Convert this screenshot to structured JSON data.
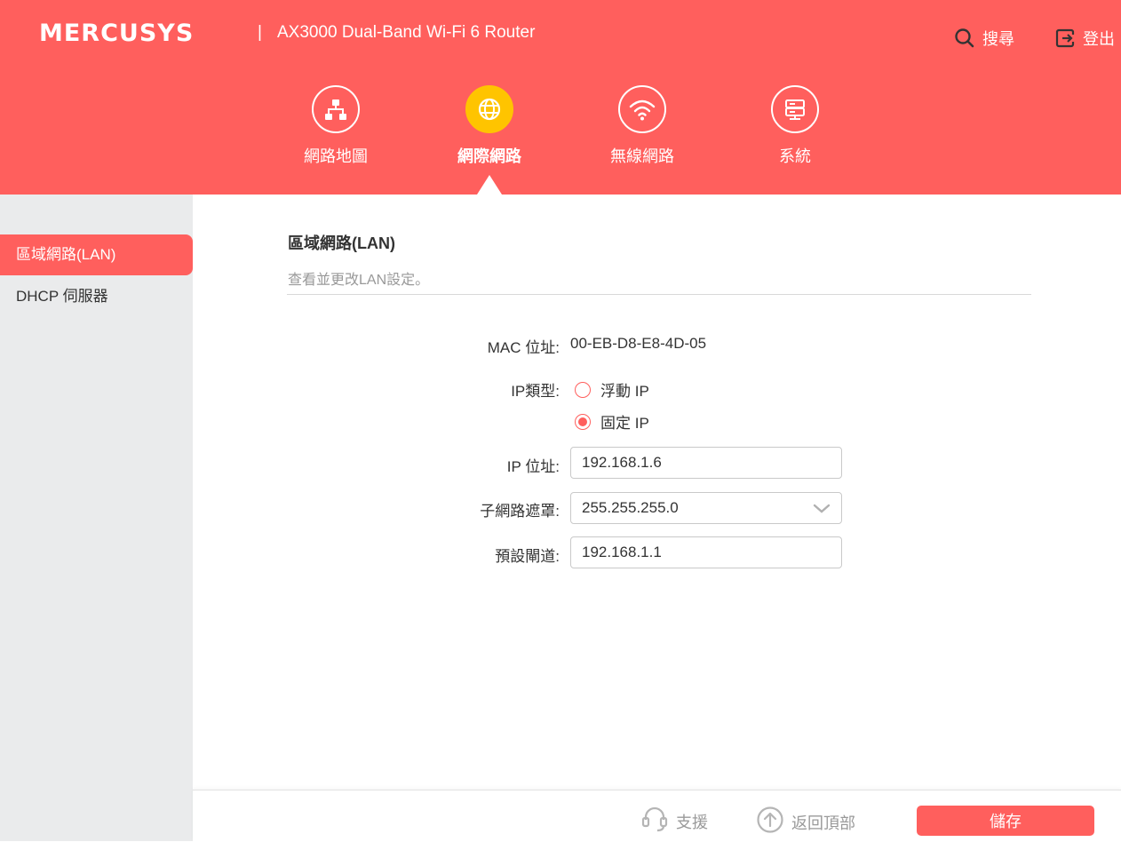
{
  "header": {
    "brand": "MERCUSYS",
    "separator": "|",
    "model": "AX3000 Dual-Band Wi-Fi 6 Router",
    "search_label": "搜尋",
    "logout_label": "登出"
  },
  "nav": {
    "tabs": [
      {
        "label": "網路地圖",
        "icon": "network-map-icon",
        "active": false
      },
      {
        "label": "網際網路",
        "icon": "globe-icon",
        "active": true
      },
      {
        "label": "無線網路",
        "icon": "wifi-icon",
        "active": false
      },
      {
        "label": "系統",
        "icon": "system-icon",
        "active": false
      }
    ]
  },
  "sidebar": {
    "items": [
      {
        "label": "區域網路(LAN)",
        "active": true
      },
      {
        "label": "DHCP 伺服器",
        "active": false
      }
    ]
  },
  "main": {
    "title": "區域網路(LAN)",
    "description": "查看並更改LAN設定。",
    "mac_label": "MAC 位址:",
    "mac_value": "00-EB-D8-E8-4D-05",
    "ip_type_label": "IP類型:",
    "ip_type_options": [
      {
        "label": "浮動 IP",
        "selected": false
      },
      {
        "label": "固定 IP",
        "selected": true
      }
    ],
    "ip_label": "IP 位址:",
    "ip_value": "192.168.1.6",
    "subnet_label": "子網路遮罩:",
    "subnet_value": "255.255.255.0",
    "gateway_label": "預設閘道:",
    "gateway_value": "192.168.1.1"
  },
  "footer": {
    "support_label": "支援",
    "back_to_top_label": "返回頂部",
    "save_label": "儲存"
  },
  "colors": {
    "brand": "#ff5f5d",
    "active_tab": "#ffc400",
    "sidebar_bg": "#eaebec"
  }
}
